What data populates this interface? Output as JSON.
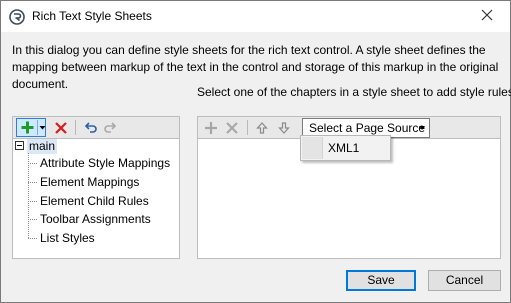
{
  "window": {
    "title": "Rich Text Style Sheets"
  },
  "intro_text": "In this dialog you can define style sheets for the rich text control. A style sheet defines the mapping between markup of the text in the control and storage of this markup in the original document.",
  "hint_text": "Select one of the chapters in a style sheet to add style rules.",
  "tree": {
    "root_label": "main",
    "children": [
      "Attribute Style Mappings",
      "Element Mappings",
      "Element Child Rules",
      "Toolbar Assignments",
      "List Styles"
    ]
  },
  "right_toolbar": {
    "page_source_label": "Select a Page Source"
  },
  "page_source_menu": {
    "items": [
      "XML1"
    ]
  },
  "buttons": {
    "save_label": "Save",
    "cancel_label": "Cancel"
  },
  "colors": {
    "accent": "#0078d7",
    "add_green": "#1e9c2a",
    "delete_red": "#d61c1c",
    "selection": "#dbe8f7"
  },
  "icons": {
    "app": "app-logo-icon",
    "close": "close-icon",
    "add": "plus-icon",
    "delete": "x-icon",
    "undo": "undo-icon",
    "redo": "redo-icon",
    "move_up": "arrow-up-icon",
    "move_down": "arrow-down-icon"
  }
}
